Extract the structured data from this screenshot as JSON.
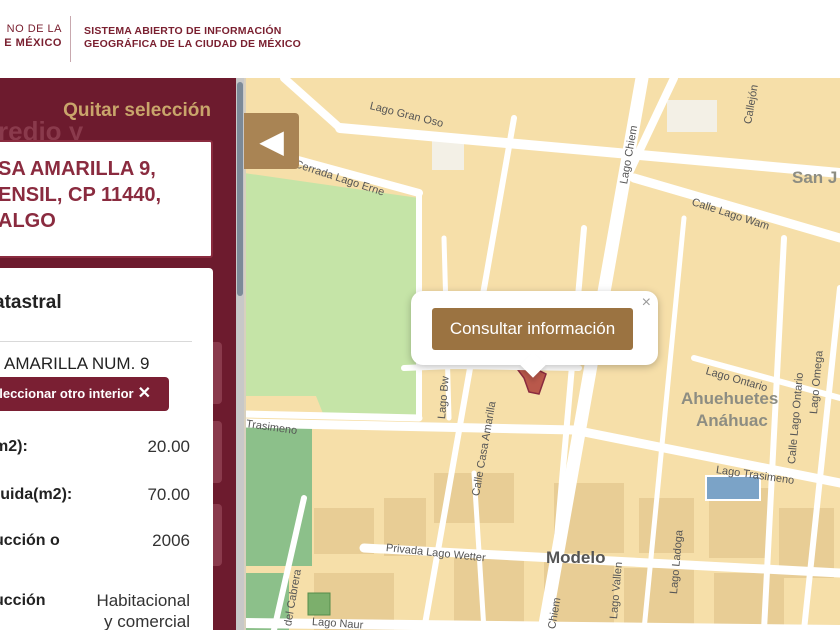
{
  "header": {
    "gov_logo_line1": "NO DE LA",
    "gov_logo_line2": "E MÉXICO",
    "site_title_line1": "SISTEMA ABIERTO DE INFORMACIÓN",
    "site_title_line2": "GEOGRÁFICA DE LA CIUDAD DE MÉXICO"
  },
  "side_panel": {
    "quitar_label": "Quitar selección",
    "ghost_title": "redio y",
    "address_lines": [
      "SA AMARILLA 9,",
      "ENSIL, CP 11440,",
      "ALGO"
    ],
    "card_title": "atastral",
    "address_value": " AMARILLA NUM. 9",
    "select_other_label": "eleccionar otro interior",
    "select_other_icon": "close-icon",
    "rows": [
      {
        "label": "m2):",
        "value": "20.00"
      },
      {
        "label": "ruida(m2):",
        "value": "70.00"
      },
      {
        "label": "ucción o",
        "value": "2006"
      },
      {
        "label": "ucción",
        "value_line1": "Habitacional",
        "value_line2": "y comercial"
      }
    ]
  },
  "map": {
    "collapse_icon": "triangle-left-icon",
    "street_labels": {
      "gran_oso": "Lago Gran Oso",
      "erne": "Cerrada Lago Erne",
      "chiem_top": "Lago Chiem",
      "callejon": "Callejón",
      "wam": "Calle Lago Wam",
      "lago_bw": "Lago Bw",
      "casa_amarilla": "Calle Casa Amarilla",
      "ontario": "Lago Ontario",
      "lago_ontario_v": "Calle Lago Ontario",
      "omega": "Lago Omega",
      "trasimeno_left": "Trasimeno",
      "trasimeno_right": "Lago Trasimeno",
      "wetter": "Privada Lago Wetter",
      "vallen": "Lago Vallen",
      "ladoga": "Lago Ladoga",
      "chiem_bottom": "Chiem",
      "cabrera": "del Cabrera",
      "naur": "Lago Naur"
    },
    "place_labels": {
      "san_j": "San J",
      "ahuehuetes_1": "Ahuehuetes",
      "ahuehuetes_2": "Anáhuac",
      "modelo": "Modelo"
    },
    "popup": {
      "button_label": "Consultar información",
      "close_symbol": "×"
    }
  },
  "colors": {
    "maroon": "#6d1b2e",
    "gold": "#c9a56b",
    "map_block": "#f6dfa9",
    "park": "#c5e4a7",
    "water": "#7ba3c7",
    "popup_button": "#9b7341"
  }
}
